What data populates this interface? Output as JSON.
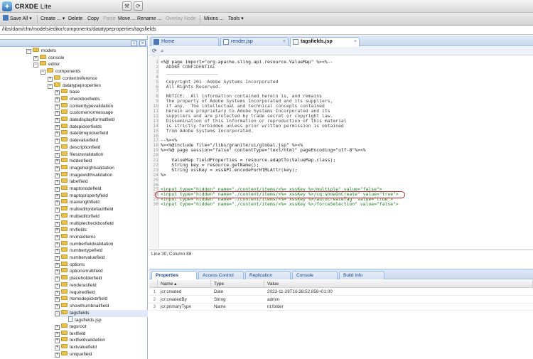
{
  "app": {
    "brand_strong": "CRXDE",
    "brand_light": "Lite"
  },
  "toolbar": {
    "items": [
      "Save All",
      "Create ...",
      "Delete",
      "Copy",
      "Paste",
      "Move ...",
      "Rename ...",
      "Overlay Node ...",
      "Mixins ...",
      "Tools"
    ]
  },
  "path": "/libs/dam/cfm/models/editor/components/datatypeproperties/tagsfields",
  "tree": {
    "nodes": [
      "models",
      "console",
      "editor",
      "components",
      "contentreference",
      "datatypeproperties",
      "base",
      "checkboxfields",
      "contenttypevalidation",
      "customerrormessage",
      "datedisplayformatfield",
      "datepickerfields",
      "datetimepickerfield",
      "datevaluefield",
      "descriptionfield",
      "filesizevalidation",
      "hiddenfield",
      "imageheightvalidation",
      "imagewidthvalidation",
      "labelfield",
      "maptonodefield",
      "maptopropertyfield",
      "maxlengthfield",
      "multieditordefaultfield",
      "multieditorfield",
      "multiplecheckboxfield",
      "mvfields",
      "mvmaxitems",
      "numberfieldvalidation",
      "numbertypefield",
      "numbervaluefield",
      "options",
      "optionsmultifield",
      "placeholderfield",
      "renderasfield",
      "requiredfield",
      "rtemodepickerfield",
      "showthumbnailfield",
      "tagsfields",
      "tagsfields.jsp",
      "tagsroot",
      "textfield",
      "textfieldvalidation",
      "textvaluefield",
      "uniquefield"
    ]
  },
  "editor": {
    "tabs": [
      "Home",
      "render.jsp",
      "tagsfields.jsp"
    ],
    "status": "Line 30, Column 88",
    "line_numbers": [
      "1",
      "2",
      "3",
      "4",
      "5",
      "6",
      "7",
      "8",
      "9",
      "10",
      "11",
      "12",
      "13",
      "14",
      "15",
      "16",
      "17",
      "18",
      "19",
      "20",
      "21",
      "22",
      "23",
      "24",
      "25",
      "26",
      "27",
      "28",
      "29",
      "30"
    ],
    "lines": [
      "<%@ page import=\"org.apache.sling.api.resource.ValueMap\" %><%--",
      "  ADOBE CONFIDENTIAL",
      "  ___________________",
      "",
      "  Copyright 201  Adobe Systems Incorporated",
      "  All Rights Reserved.",
      "",
      "  NOTICE:  All information contained herein is, and remains",
      "  the property of Adobe Systems Incorporated and its suppliers,",
      "  if any.  The intellectual and technical concepts contained",
      "  herein are proprietary to Adobe Systems Incorporated and its",
      "  suppliers and are protected by trade secret or copyright law.",
      "  Dissemination of this information or reproduction of this material",
      "  is strictly forbidden unless prior written permission is obtained",
      "  from Adobe Systems Incorporated.",
      "",
      "--%><%",
      "%><%@include file=\"/libs/granite/ui/global.jsp\" %><%",
      "%><%@ page session=\"false\" contentType=\"text/html\" pageEncoding=\"utf-8\"%><%",
      "",
      "    ValueMap fieldProperties = resource.adaptTo(ValueMap.class);",
      "    String key = resource.getName();",
      "    String xssKey = xssAPI.encodeForHTMLAttr(key);",
      "%>",
      "",
      "",
      "<input type=\"hidden\" name=\"./content/items/<%= xssKey %>/multiple\" value=\"false\">",
      "<input type=\"hidden\" name=\"./content/items/<%= xssKey %>/cq:showOnCreate\" value=\"true\">",
      "<input type=\"hidden\" name=\"./content/items/<%= xssKey %>/autocreateTag\" value=\"true\">",
      "<input type=\"hidden\" name=\"./content/items/<%= xssKey %>/forceSelection\" value=\"false\">"
    ]
  },
  "bottom_tabs": [
    "Properties",
    "Access Control",
    "Replication",
    "Console",
    "Build Info"
  ],
  "properties": {
    "headers": [
      "Name ▴",
      "Type",
      "Value"
    ],
    "rows": [
      {
        "n": "1",
        "name": "jcr:created",
        "type": "Date",
        "value": "2023-11-28T16:38:52.858+01:00"
      },
      {
        "n": "2",
        "name": "jcr:createdBy",
        "type": "String",
        "value": "admin"
      },
      {
        "n": "3",
        "name": "jcr:primaryType",
        "type": "Name",
        "value": "nt:folder"
      }
    ]
  }
}
